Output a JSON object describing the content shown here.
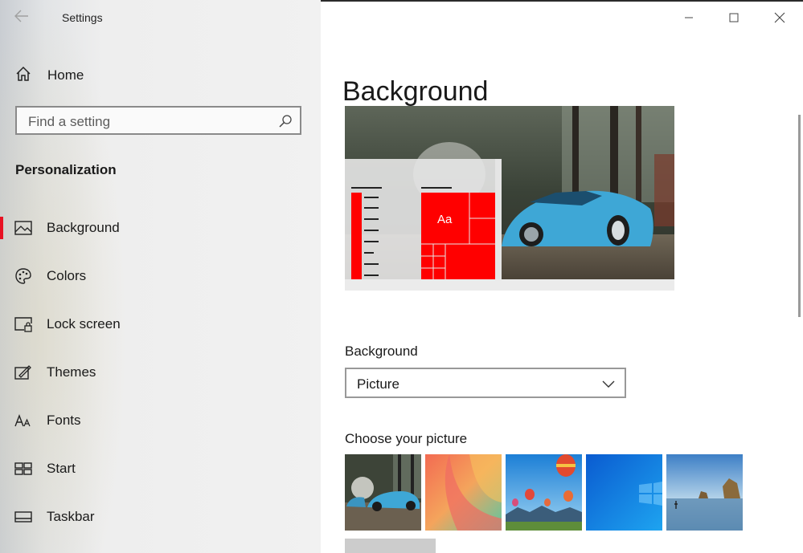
{
  "window": {
    "title": "Settings"
  },
  "sidebar": {
    "home_label": "Home",
    "search_placeholder": "Find a setting",
    "section_title": "Personalization",
    "items": [
      {
        "label": "Background",
        "icon": "picture-icon",
        "active": true
      },
      {
        "label": "Colors",
        "icon": "palette-icon"
      },
      {
        "label": "Lock screen",
        "icon": "lock-screen-icon"
      },
      {
        "label": "Themes",
        "icon": "themes-icon"
      },
      {
        "label": "Fonts",
        "icon": "fonts-icon"
      },
      {
        "label": "Start",
        "icon": "start-icon"
      },
      {
        "label": "Taskbar",
        "icon": "taskbar-icon"
      }
    ]
  },
  "main": {
    "title": "Background",
    "preview_sample_text": "Aa",
    "background_label": "Background",
    "background_value": "Picture",
    "choose_label": "Choose your picture",
    "thumbnails": [
      "car-photo",
      "abstract-gradient",
      "hot-air-balloons",
      "windows-blue",
      "beach-rocks"
    ]
  },
  "colors": {
    "accent": "#e81123",
    "tile_red": "#ff0000"
  }
}
